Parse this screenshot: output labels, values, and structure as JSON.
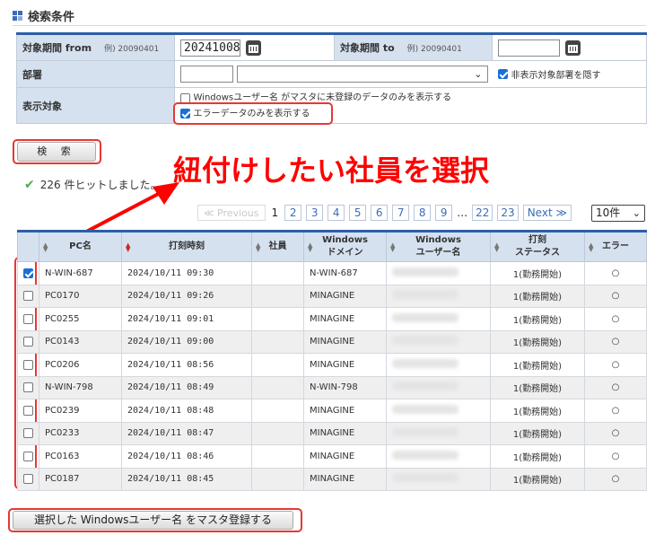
{
  "header": {
    "title": "検索条件"
  },
  "search": {
    "period_from_label": "対象期間 from",
    "period_from_example": "例) 20090401",
    "period_from_value": "20241008",
    "period_to_label": "対象期間 to",
    "period_to_example": "例) 20090401",
    "period_to_value": "",
    "dept_label": "部署",
    "hide_dept_label": "非表示対象部署を隠す",
    "target_label": "表示対象",
    "opt_unregistered_label": "Windowsユーザー名 がマスタに未登録のデータのみを表示する",
    "opt_error_only_label": "エラーデータのみを表示する",
    "search_button": "検 索"
  },
  "annotation": "紐付けしたい社員を選択",
  "result_summary": "226 件ヒットしました。",
  "pager": {
    "prev": "≪ Previous",
    "current": "1",
    "pages": [
      "2",
      "3",
      "4",
      "5",
      "6",
      "7",
      "8",
      "9"
    ],
    "ellipsis": "…",
    "tail_pages": [
      "22",
      "23"
    ],
    "next": "Next ≫",
    "per_page": "10件"
  },
  "table": {
    "headers": {
      "pc": "PC名",
      "time": "打刻時刻",
      "employee": "社員",
      "domain_1": "Windows",
      "domain_2": "ドメイン",
      "user_1": "Windows",
      "user_2": "ユーザー名",
      "status_1": "打刻",
      "status_2": "ステータス",
      "error": "エラー"
    },
    "rows": [
      {
        "pc": "N-WIN-687",
        "time": "2024/10/11 09:30",
        "domain": "N-WIN-687",
        "status": "1(勤務開始)",
        "error": "○"
      },
      {
        "pc": "PC0170",
        "time": "2024/10/11 09:26",
        "domain": "MINAGINE",
        "status": "1(勤務開始)",
        "error": "○"
      },
      {
        "pc": "PC0255",
        "time": "2024/10/11 09:01",
        "domain": "MINAGINE",
        "status": "1(勤務開始)",
        "error": "○"
      },
      {
        "pc": "PC0143",
        "time": "2024/10/11 09:00",
        "domain": "MINAGINE",
        "status": "1(勤務開始)",
        "error": "○"
      },
      {
        "pc": "PC0206",
        "time": "2024/10/11 08:56",
        "domain": "MINAGINE",
        "status": "1(勤務開始)",
        "error": "○"
      },
      {
        "pc": "N-WIN-798",
        "time": "2024/10/11 08:49",
        "domain": "N-WIN-798",
        "status": "1(勤務開始)",
        "error": "○"
      },
      {
        "pc": "PC0239",
        "time": "2024/10/11 08:48",
        "domain": "MINAGINE",
        "status": "1(勤務開始)",
        "error": "○"
      },
      {
        "pc": "PC0233",
        "time": "2024/10/11 08:47",
        "domain": "MINAGINE",
        "status": "1(勤務開始)",
        "error": "○"
      },
      {
        "pc": "PC0163",
        "time": "2024/10/11 08:46",
        "domain": "MINAGINE",
        "status": "1(勤務開始)",
        "error": "○"
      },
      {
        "pc": "PC0187",
        "time": "2024/10/11 08:45",
        "domain": "MINAGINE",
        "status": "1(勤務開始)",
        "error": "○"
      }
    ]
  },
  "register_button": "選択した Windowsユーザー名 をマスタ登録する",
  "colors": {
    "accent": "#2c5ea8",
    "annotation": "#ff0000",
    "header_bg": "#d6e1f0"
  }
}
